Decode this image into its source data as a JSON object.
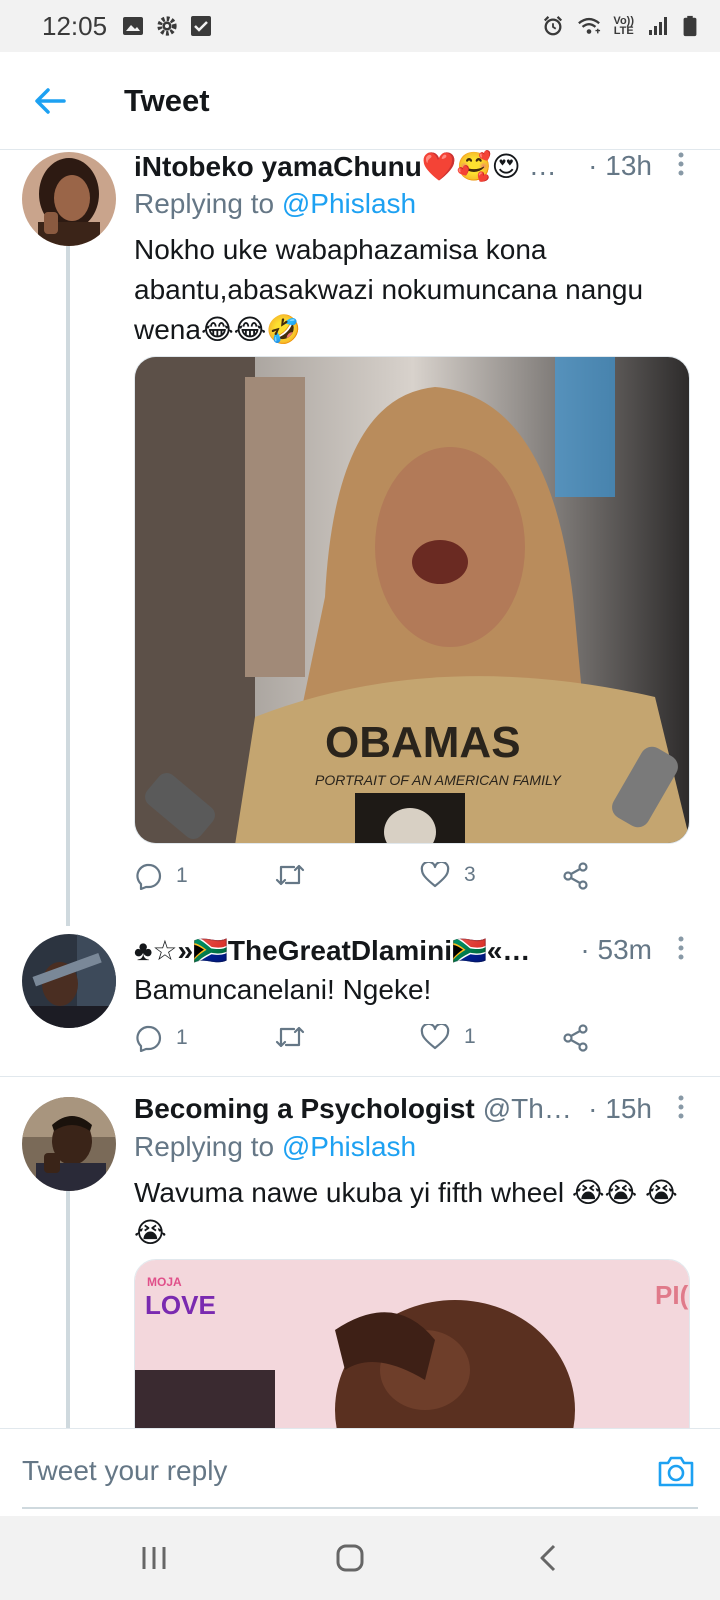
{
  "status_bar": {
    "time": "12:05",
    "left_icons": [
      "image-icon",
      "gear-icon",
      "checkbox-icon"
    ],
    "right_icons": [
      "alarm-icon",
      "wifi-icon",
      "volte-icon",
      "signal-icon",
      "battery-icon"
    ],
    "volte_top": "Vo))",
    "volte_bottom": "LTE"
  },
  "header": {
    "back_icon": "arrow-left-icon",
    "title": "Tweet"
  },
  "colors": {
    "accent": "#1da1f2",
    "text": "#14171a",
    "muted": "#657786",
    "heart": "#e0245e"
  },
  "tweets": [
    {
      "name": "iNtobeko yamaChunu❤️🥰😍",
      "ellipsis": "…",
      "handle": "",
      "time": "· 13h",
      "reply_prefix": "Replying to ",
      "reply_to": "@Phislash",
      "text": "Nokho uke wabaphazamisa kona abantu,abasakwazi nokumuncana nangu wena😂😂🤣",
      "media_shirt_text": "OBAMAS",
      "media_shirt_sub": "PORTRAIT OF AN AMERICAN FAMILY",
      "replies": "1",
      "retweets": "",
      "likes": "3"
    },
    {
      "name": "♣☆»🇿🇦TheGreatDlamini🇿🇦«…",
      "handle": "",
      "time": "· 53m",
      "text": "Bamuncanelani! Ngeke!",
      "replies": "1",
      "retweets": "",
      "likes": "1"
    },
    {
      "name": "Becoming a Psychologist",
      "handle": "@Th…",
      "time": "· 15h",
      "reply_prefix": "Replying to ",
      "reply_to": "@Phislash",
      "text": "Wavuma nawe ukuba yi fifth wheel 😭😭 😭😭",
      "media_logo_top": "MOJA",
      "media_logo_bottom": "LOVE",
      "media_corner_text": "PI("
    }
  ],
  "reply_bar": {
    "placeholder": "Tweet your reply",
    "camera_icon": "camera-icon"
  },
  "nav_bar": {
    "icons": [
      "recent-apps-icon",
      "home-icon",
      "back-icon"
    ]
  }
}
